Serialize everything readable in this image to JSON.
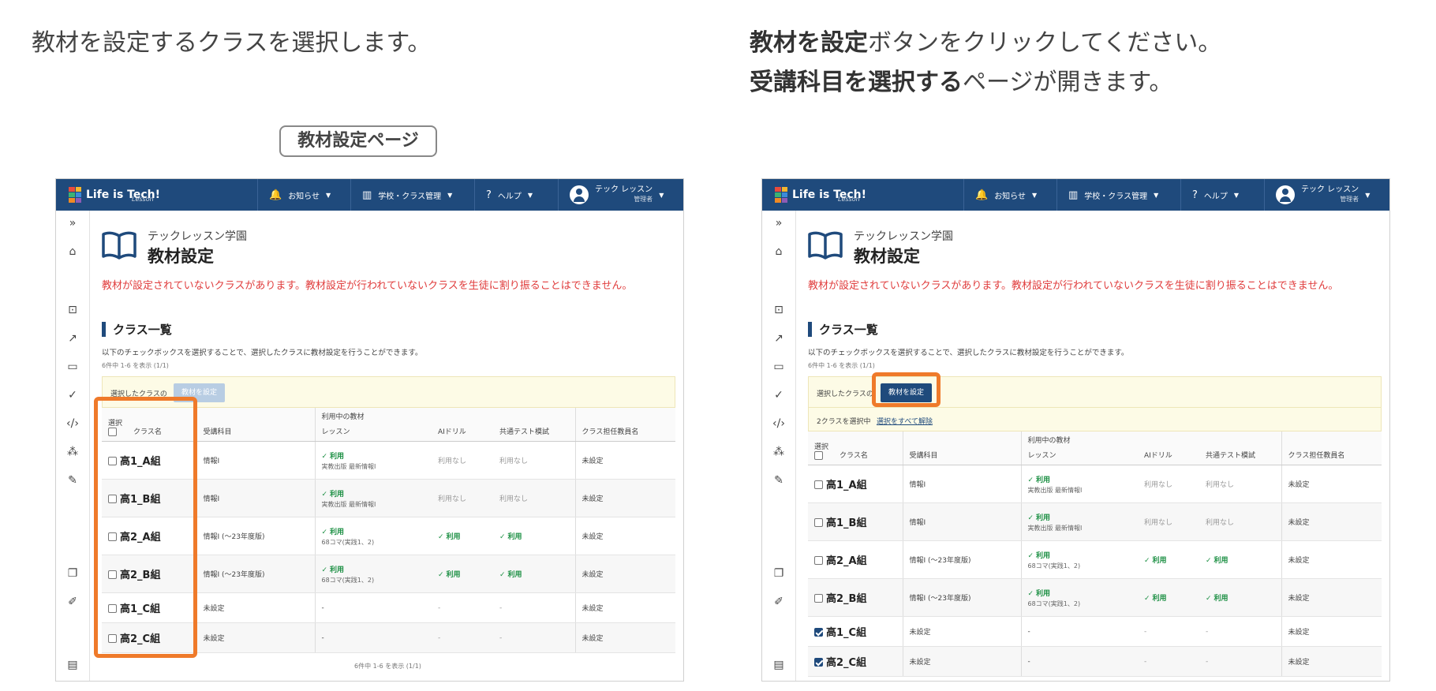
{
  "left": {
    "caption": "教材を設定するクラスを選択します。",
    "page_tag": "教材設定ページ"
  },
  "right": {
    "caption_line1_bold": "教材を設定",
    "caption_line1_rest": "ボタンをクリックしてください。",
    "caption_line2_bold": "受講科目を選択する",
    "caption_line2_rest": "ページが開きます。"
  },
  "app": {
    "logo_text": "Life is Tech!",
    "logo_sub": "Lesson",
    "nav": {
      "news": "お知らせ",
      "school": "学校・クラス管理",
      "help": "ヘルプ",
      "user_name": "テック レッスン",
      "user_role": "管理者"
    },
    "school_name": "テックレッスン学園",
    "page_title": "教材設定",
    "warning": "教材が設定されていないクラスがあります。教材設定が行われていないクラスを生徒に割り振ることはできません。",
    "section_title": "クラス一覧",
    "description": "以下のチェックボックスを選択することで、選択したクラスに教材設定を行うことができます。",
    "count_text": "6件中 1-6 を表示 (1/1)",
    "action_label": "選択したクラスの",
    "set_button": "教材を設定",
    "selected_count": "2クラスを選択中",
    "clear_selection": "選択をすべて解除",
    "headers": {
      "select": "選択",
      "class_name": "クラス名",
      "subject": "受講科目",
      "materials_group": "利用中の教材",
      "lesson": "レッスン",
      "ai_drill": "AIドリル",
      "common_test": "共通テスト模試",
      "teacher": "クラス担任教員名"
    },
    "rows": [
      {
        "name": "高1_A組",
        "subject": "情報Ⅰ",
        "lesson": "利用",
        "lesson_sub": "実教出版 最新情報Ⅰ",
        "ai": "利用なし",
        "test": "利用なし",
        "teacher": "未設定"
      },
      {
        "name": "高1_B組",
        "subject": "情報Ⅰ",
        "lesson": "利用",
        "lesson_sub": "実教出版 最新情報Ⅰ",
        "ai": "利用なし",
        "test": "利用なし",
        "teacher": "未設定"
      },
      {
        "name": "高2_A組",
        "subject": "情報Ⅰ (〜23年度版)",
        "lesson": "利用",
        "lesson_sub": "68コマ(実践1、2)",
        "ai": "利用",
        "test": "利用",
        "teacher": "未設定"
      },
      {
        "name": "高2_B組",
        "subject": "情報Ⅰ (〜23年度版)",
        "lesson": "利用",
        "lesson_sub": "68コマ(実践1、2)",
        "ai": "利用",
        "test": "利用",
        "teacher": "未設定"
      },
      {
        "name": "高1_C組",
        "subject": "未設定",
        "lesson": "-",
        "ai": "-",
        "test": "-",
        "teacher": "未設定"
      },
      {
        "name": "高2_C組",
        "subject": "未設定",
        "lesson": "-",
        "ai": "-",
        "test": "-",
        "teacher": "未設定"
      }
    ]
  },
  "colors": {
    "navy": "#1f4a7c",
    "highlight": "#ef7a2a",
    "warning": "#e03c3c",
    "ok_green": "#1f9146"
  }
}
